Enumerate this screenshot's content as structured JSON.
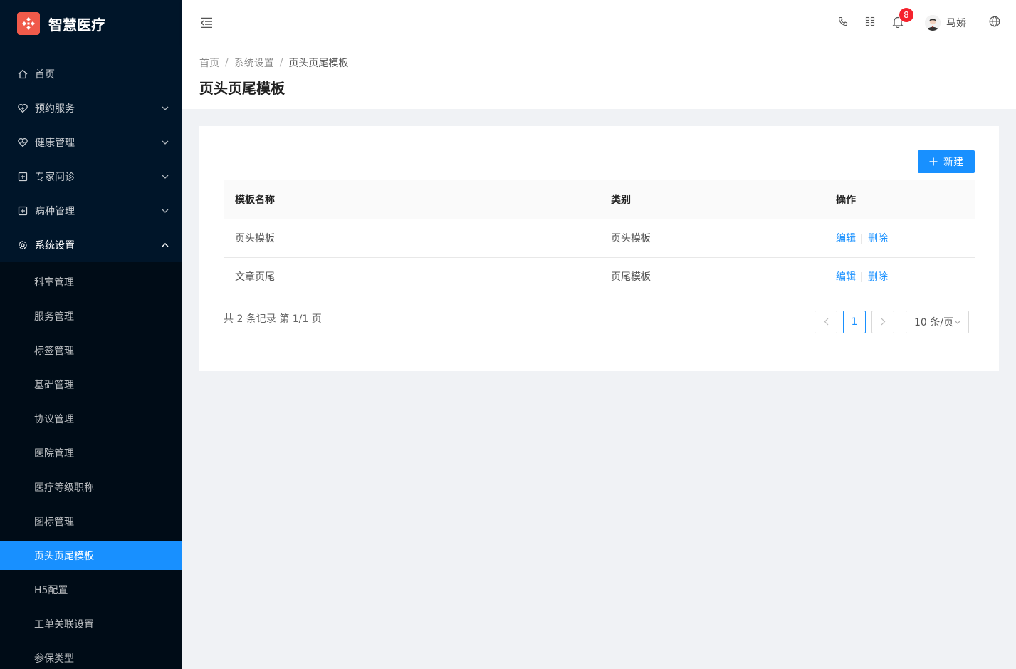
{
  "app": {
    "title": "智慧医疗"
  },
  "sidebar": {
    "items": [
      {
        "label": "首页",
        "icon": "home-icon"
      },
      {
        "label": "预约服务",
        "icon": "heart-shield-icon"
      },
      {
        "label": "健康管理",
        "icon": "heart-pulse-icon"
      },
      {
        "label": "专家问诊",
        "icon": "medical-plus-icon"
      },
      {
        "label": "病种管理",
        "icon": "medical-plus-icon"
      },
      {
        "label": "系统设置",
        "icon": "gear-icon"
      }
    ],
    "system_submenu": [
      "科室管理",
      "服务管理",
      "标签管理",
      "基础管理",
      "协议管理",
      "医院管理",
      "医疗等级职称",
      "图标管理",
      "页头页尾模板",
      "H5配置",
      "工单关联设置",
      "参保类型"
    ],
    "active_submenu": "页头页尾模板"
  },
  "header": {
    "notification_count": "8",
    "user_name": "马娇"
  },
  "breadcrumb": {
    "home": "首页",
    "parent": "系统设置",
    "current": "页头页尾模板"
  },
  "page": {
    "title": "页头页尾模板"
  },
  "toolbar": {
    "new_label": "新建"
  },
  "table": {
    "columns": [
      "模板名称",
      "类别",
      "操作"
    ],
    "rows": [
      {
        "name": "页头模板",
        "category": "页头模板",
        "edit": "编辑",
        "delete": "删除"
      },
      {
        "name": "文章页尾",
        "category": "页尾模板",
        "edit": "编辑",
        "delete": "删除"
      }
    ]
  },
  "pagination": {
    "summary": "共 2 条记录 第 1/1 页",
    "current_page": "1",
    "page_size": "10 条/页"
  },
  "colors": {
    "primary": "#1890ff",
    "sidebar_bg": "#001529",
    "submenu_bg": "#000c17",
    "logo": "#f05a4a",
    "badge": "#f5222d"
  }
}
